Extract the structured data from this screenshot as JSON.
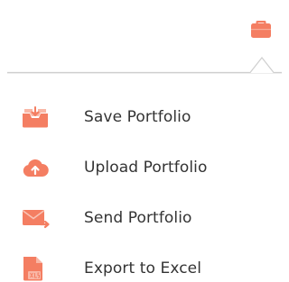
{
  "trigger": {
    "icon": "briefcase-icon",
    "color": "#F47E62"
  },
  "menu": {
    "items": [
      {
        "label": "Save Portfolio",
        "icon": "save-tray-icon"
      },
      {
        "label": "Upload Portfolio",
        "icon": "cloud-upload-icon"
      },
      {
        "label": "Send Portfolio",
        "icon": "envelope-send-icon"
      },
      {
        "label": "Export to Excel",
        "icon": "excel-file-icon"
      }
    ]
  },
  "colors": {
    "accent": "#F47E62",
    "text": "#333333",
    "border": "#CFCFCF"
  }
}
